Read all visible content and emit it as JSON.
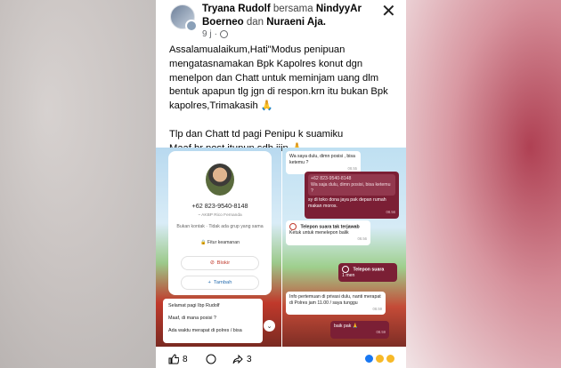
{
  "post": {
    "author": "Tryana Rudolf",
    "with_word": "bersama",
    "tagged_1": "NindyyAr Boerneo",
    "and_word": "dan",
    "tagged_2": "Nuraeni Aja.",
    "time": "9 j",
    "close_label": "✕",
    "paragraph_1": "Assalamualaikum,Hati\"Modus penipuan mengatasnamakan Bpk Kapolres konut dgn menelpon dan Chatt untuk meminjam uang dlm bentuk apapun tlg jgn di respon.krn itu bukan Bpk kapolres,Trimakasih 🙏",
    "paragraph_2": "Tlp dan Chatt td pagi Penipu k suamiku\nMaaf br post itupun sdh ijin 🙏"
  },
  "contact_card": {
    "phone": "+62 823-9540-8148",
    "name": "~ AKBP Rico Fernanda",
    "desc": "Bukan kontak · Tidak ada grup yang sama",
    "security": "Fitur keamanan",
    "block": "Blokir",
    "add": "Tambah"
  },
  "chat_left": {
    "line_1": "Selamat pagi Ibp Rudolf",
    "line_2": "Maaf, di mana posisi ?",
    "line_3": "Ada waktu merapat di polres / bisa",
    "down": "⌄"
  },
  "chat_right": {
    "msg_1": "Wa saya dulu, dimn posisi , bisa ketemu ?",
    "msg_1_time": "08.55",
    "quote_phone": "+62 823-9540-8148",
    "quote_text": "Wa saja dulu, dimn posisi, bisa ketemu ?",
    "reply": "sy di toko dona jaya pak depan rumah makan moros.",
    "reply_time": "08.56",
    "call_title": "Telepon suara tak terjawab",
    "call_sub": "Ketuk untuk menelepon balik",
    "call_time": "08.56",
    "voice_title": "Telepon suara",
    "voice_sub": "1 men",
    "info": "Info pertemuan di privasi dulu, nanti merapat di Polres jam 11.00 / saya tunggu",
    "info_time": "08.59",
    "ok": "baik pak 🙏",
    "ok_time": "08.59"
  },
  "reactions": {
    "likes": "8",
    "shares": "3"
  },
  "colors": {
    "chat_out": "#7b1f35",
    "like_blue": "#1877f2"
  }
}
